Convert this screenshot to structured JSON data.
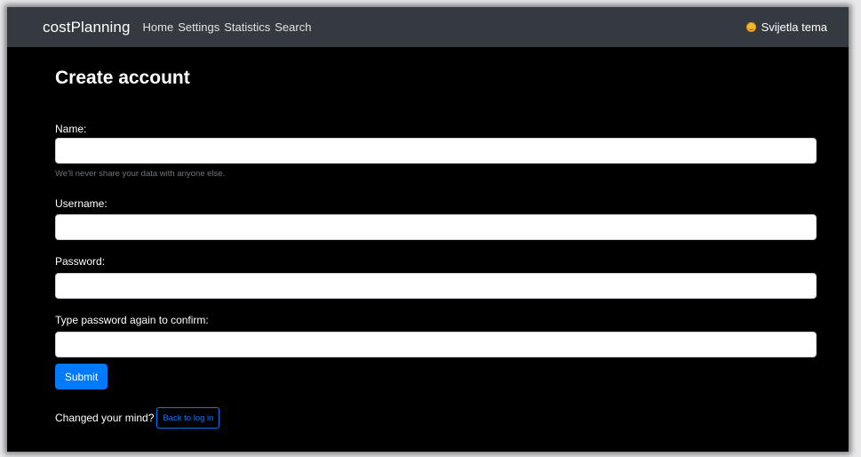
{
  "navbar": {
    "brand": "costPlanning",
    "links": [
      {
        "label": "Home"
      },
      {
        "label": "Settings"
      },
      {
        "label": "Statistics"
      },
      {
        "label": "Search"
      }
    ],
    "theme_toggle": {
      "label": "Svijetla tema",
      "icon": "sun-icon"
    }
  },
  "form": {
    "title": "Create account",
    "name_label": "Name:",
    "name_value": "",
    "name_help": "We'll never share your data with anyone else.",
    "username_label": "Username:",
    "username_value": "",
    "password_label": "Password:",
    "password_value": "",
    "confirm_label": "Type password again to confirm:",
    "confirm_value": "",
    "submit_label": "Submit",
    "changed_mind_text": "Changed your mind?",
    "back_label": "Back to log in"
  },
  "colors": {
    "navbar_bg": "#343a40",
    "page_bg": "#000000",
    "primary": "#007bff",
    "help_text": "#6c757d"
  }
}
